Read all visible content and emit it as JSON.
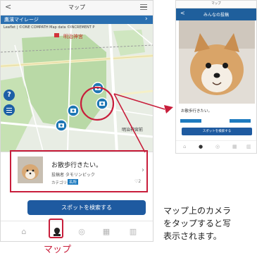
{
  "main_screen": {
    "header": {
      "title": "マップ"
    },
    "blue_bar": {
      "label": "鷹濱マイレージ"
    },
    "map": {
      "attribution": "Leaflet | ©ONE COMPATH Map data ©INCREMENT P",
      "place_labels": [
        "明治神宮",
        "明治神宮前"
      ]
    },
    "post": {
      "title": "お散歩行きたい。",
      "author": "投稿者 タモリンピック",
      "category_label": "カテゴリー",
      "category_badge": "名所",
      "likes": "♡2"
    },
    "search_button": {
      "label": "スポットを検索する"
    },
    "nav_items": [
      "home-icon",
      "map-pin-icon",
      "camera-icon",
      "grid-icon",
      "chart-icon"
    ],
    "caption": "マップ"
  },
  "detail_screen": {
    "header_small": "マップ",
    "header": "みんなの投稿",
    "caption": "お散歩行きたい。",
    "search_button": "スポットを検索する"
  },
  "description": [
    "マップ上のカメラ",
    "をタップすると写",
    "表示されます。"
  ],
  "colors": {
    "accent_red": "#c81e3b",
    "brand_blue": "#1e5aa0"
  }
}
